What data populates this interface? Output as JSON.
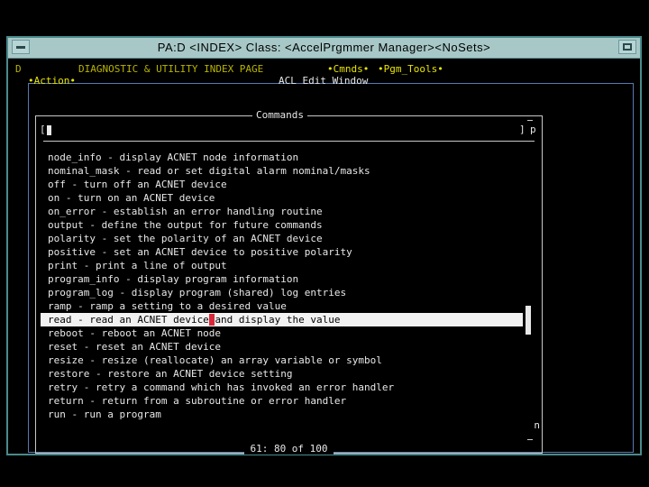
{
  "window": {
    "title": "PA:D <INDEX> Class: <AccelPrgmmer Manager><NoSets>"
  },
  "header": {
    "prefix": "D",
    "page_title": "DIAGNOSTIC & UTILITY INDEX PAGE",
    "cmnds_menu": "•Cmnds•",
    "pgm_tools_menu": "•Pgm_Tools•",
    "action_menu": "•Action•",
    "window_label": "ACL Edit Window"
  },
  "commands_panel": {
    "title": "Commands",
    "input_open": "[",
    "input_close": "]",
    "input_side_letter": "p",
    "scroll_bottom_letter": "n",
    "status": "61: 80 of 100",
    "items": [
      "node_info - display ACNET node information",
      "nominal_mask - read or set digital alarm nominal/masks",
      "off - turn off an ACNET device",
      "on - turn on an ACNET device",
      "on_error - establish an error handling routine",
      "output - define the output for future commands",
      "polarity - set the polarity of an ACNET device",
      "positive - set an ACNET device to positive polarity",
      "print - print a line of output",
      "program_info - display program information",
      "program_log - display program (shared) log entries",
      "ramp - ramp a setting to a desired value",
      "read - read an ACNET device and display the value",
      "reboot - reboot an ACNET node",
      "reset - reset an ACNET device",
      "resize - resize (reallocate) an array variable or symbol",
      "restore - restore an ACNET device setting",
      "retry - retry a command which has invoked an error handler",
      "return - return from a subroutine or error handler",
      "run - run a program"
    ],
    "selected": {
      "before": "read - read an ACNET device",
      "cursor": " ",
      "after": "and display the value"
    }
  },
  "colors": {
    "titlebar": "#a8c8c8",
    "window_border": "#4a8a8c",
    "menu_yellow": "#e8e400",
    "header_yellow": "#b8b400",
    "frame_blue": "#5a78b0",
    "cursor_red": "#d8283c"
  }
}
